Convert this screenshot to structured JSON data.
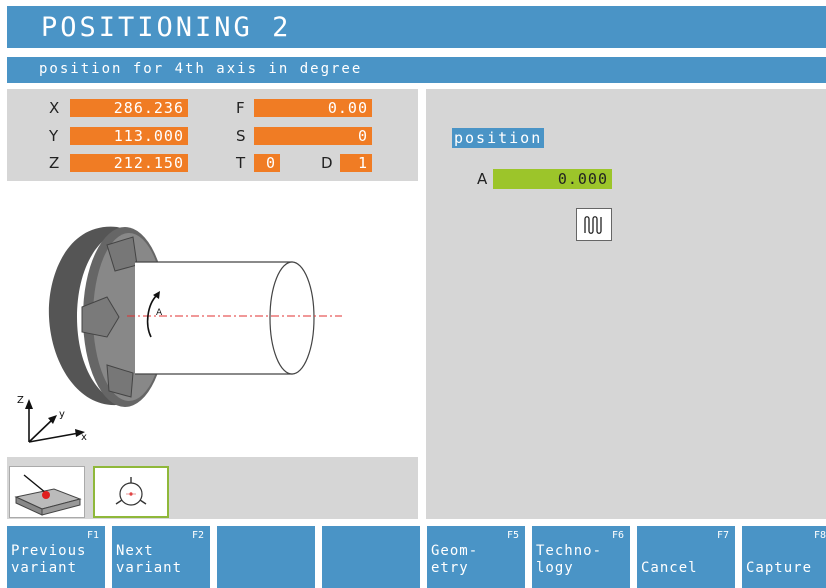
{
  "header": {
    "title": "POSITIONING 2",
    "subtitle": "position for 4th axis in degree"
  },
  "values": {
    "x": {
      "label": "X",
      "value": "286.236"
    },
    "y": {
      "label": "Y",
      "value": "113.000"
    },
    "z": {
      "label": "Z",
      "value": "212.150"
    },
    "f": {
      "label": "F",
      "value": "0.00"
    },
    "s": {
      "label": "S",
      "value": "0"
    },
    "t": {
      "label": "T",
      "value": "0"
    },
    "d": {
      "label": "D",
      "value": "1"
    }
  },
  "diagram": {
    "axis_a": "A",
    "axis_z": "Z",
    "axis_y": "y",
    "axis_x": "x"
  },
  "form": {
    "section_heading": "position",
    "a_label": "A",
    "a_value": "0.000",
    "pulse_icon": "pulse-icon"
  },
  "thumbnails": [
    {
      "icon": "plane-with-point-icon",
      "selected": false
    },
    {
      "icon": "circle-center-icon",
      "selected": true
    }
  ],
  "softkeys": [
    {
      "fkey": "F1",
      "line1": "Previous",
      "line2": "variant"
    },
    {
      "fkey": "F2",
      "line1": "Next",
      "line2": "variant"
    },
    {
      "fkey": "",
      "line1": "",
      "line2": ""
    },
    {
      "fkey": "",
      "line1": "",
      "line2": ""
    },
    {
      "fkey": "F5",
      "line1": "Geom-",
      "line2": "etry"
    },
    {
      "fkey": "F6",
      "line1": "Techno-",
      "line2": "logy"
    },
    {
      "fkey": "F7",
      "line1": "",
      "line2": "Cancel"
    },
    {
      "fkey": "F8",
      "line1": "",
      "line2": "Capture"
    }
  ],
  "colors": {
    "accent_blue": "#4a94c6",
    "value_orange": "#f07c24",
    "input_green": "#9cc52a",
    "panel_gray": "#d6d6d6"
  }
}
